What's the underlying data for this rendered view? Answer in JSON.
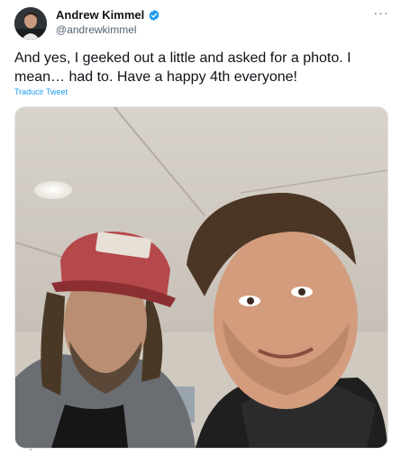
{
  "author": {
    "display_name": "Andrew Kimmel",
    "handle": "@andrewkimmel",
    "verified": true,
    "avatar_icon": "profile-photo"
  },
  "menu": {
    "more_icon": "more-horizontal-icon",
    "more_glyph": "···"
  },
  "tweet": {
    "text": "And yes, I geeked out a little and asked for a photo. I mean… had to. Have a happy 4th everyone!",
    "translate_label": "Traducir Tweet"
  },
  "media": {
    "type": "photo",
    "description_icon": "selfie-photo"
  },
  "colors": {
    "verified": "#1d9bf0",
    "link": "#1d9bf0",
    "secondary_text": "#536471",
    "primary_text": "#0f1419"
  }
}
